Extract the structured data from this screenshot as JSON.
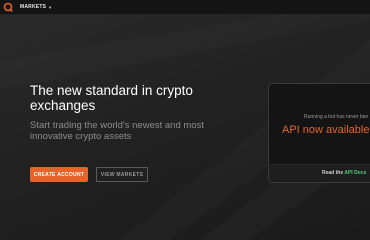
{
  "colors": {
    "accent": "#e8632a",
    "link_green": "#52c97a",
    "background": "#222222",
    "topbar": "#141414"
  },
  "topbar": {
    "logo_icon": "ring-logo-icon",
    "markets_label": "MARKETS",
    "markets_chevron_icon": "chevron-down-icon"
  },
  "hero": {
    "title": "The new standard in crypto exchanges",
    "subtitle": "Start trading the world's newest and most innovative crypto assets",
    "create_account_label": "CREATE ACCOUNT",
    "view_markets_label": "VIEW MARKETS"
  },
  "api_card": {
    "note": "Running a bot has never bee",
    "title": "API now available",
    "footer_prefix": "Read the",
    "footer_link": "API Docs"
  }
}
